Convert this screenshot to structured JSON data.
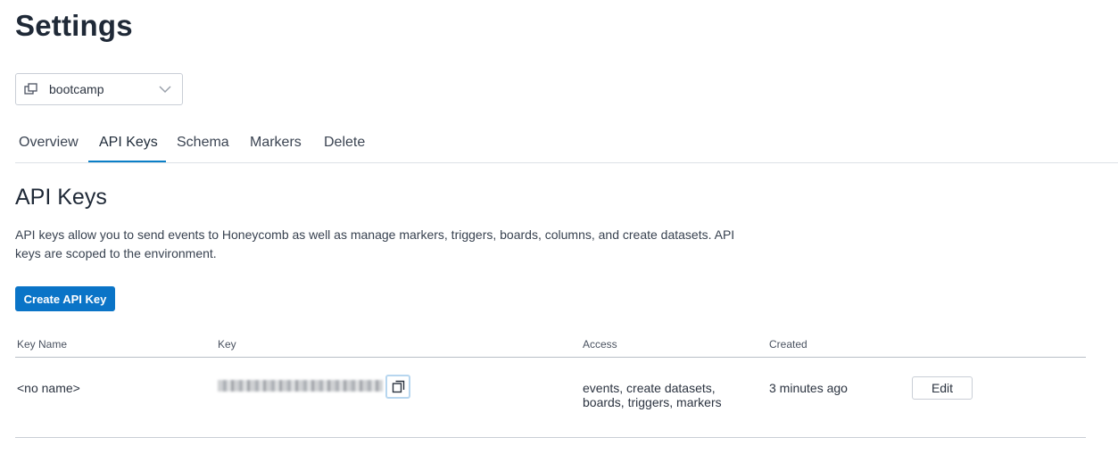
{
  "page": {
    "title": "Settings"
  },
  "environment": {
    "icon": "environment-icon",
    "name": "bootcamp",
    "chevron": "chevron-down-icon"
  },
  "tabs": [
    {
      "label": "Overview",
      "active": false
    },
    {
      "label": "API Keys",
      "active": true
    },
    {
      "label": "Schema",
      "active": false
    },
    {
      "label": "Markers",
      "active": false
    },
    {
      "label": "Delete",
      "active": false
    }
  ],
  "section": {
    "title": "API Keys",
    "description": "API keys allow you to send events to Honeycomb as well as manage markers, triggers, boards, columns, and create datasets. API keys are scoped to the environment.",
    "create_label": "Create API Key"
  },
  "table": {
    "headers": {
      "name": "Key Name",
      "key": "Key",
      "access": "Access",
      "created": "Created"
    },
    "rows": [
      {
        "name": "<no name>",
        "key_masked": true,
        "access_line1": "events, create datasets,",
        "access_line2": "boards, triggers, markers",
        "created": "3 minutes ago",
        "edit_label": "Edit"
      }
    ]
  },
  "colors": {
    "accent": "#0a74c7",
    "tab_underline": "#0b7fc7"
  }
}
